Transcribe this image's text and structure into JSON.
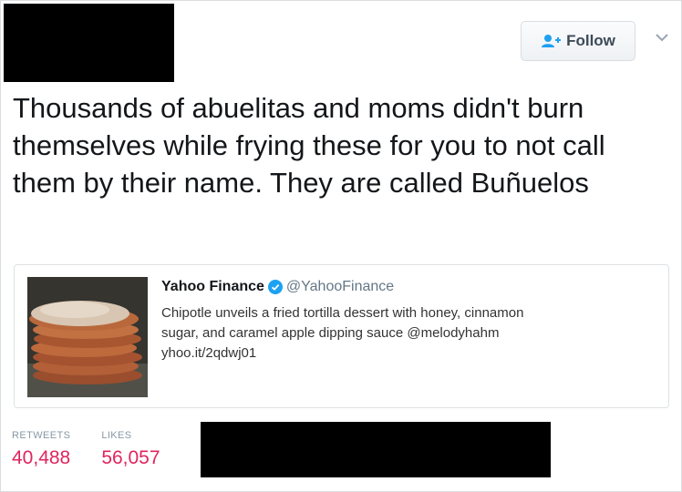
{
  "follow_button": {
    "label": "Follow",
    "icon": "follow-user-icon"
  },
  "menu": {
    "icon": "chevron-down-icon"
  },
  "tweet": {
    "text": "Thousands of abuelitas and moms didn't burn themselves while frying these for you to not call them by their name. They are called Buñuelos"
  },
  "quoted_tweet": {
    "author_name": "Yahoo Finance",
    "verified_icon": "verified-badge-icon",
    "handle": "@YahooFinance",
    "body_line1": "Chipotle unveils a fried tortilla dessert with honey, cinnamon",
    "body_line2": "sugar, and caramel apple dipping sauce @melodyhahm",
    "link": "yhoo.it/2qdwj01",
    "image": "stack-of-bunuelos-image"
  },
  "stats": {
    "retweets_label": "RETWEETS",
    "retweets_value": "40,488",
    "likes_label": "LIKES",
    "likes_value": "56,057"
  },
  "colors": {
    "accent": "#1da1f2",
    "stat_value": "#e0245e",
    "redaction": "#000000"
  }
}
